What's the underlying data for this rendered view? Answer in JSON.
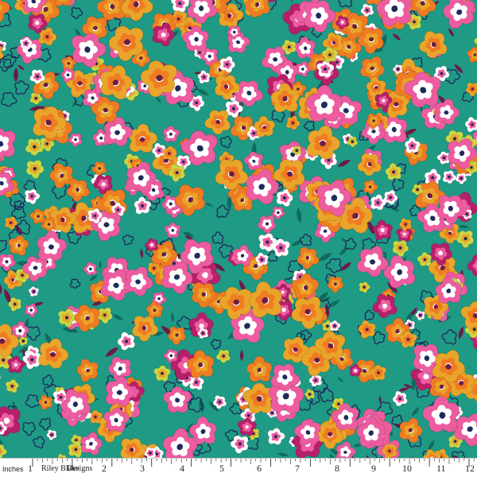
{
  "image": {
    "subject": "Floral cotton quilting fabric swatch",
    "colors": {
      "background": "#1f9a85",
      "pink": "#ec5c9e",
      "magenta": "#b61f6a",
      "orange": "#ef7b22",
      "gold": "#e9a42a",
      "lime": "#c7d847",
      "white": "#ffffff",
      "navy": "#1d2a5a",
      "teal_dark": "#0f6b5d",
      "plum": "#6a1d45"
    }
  },
  "ruler": {
    "unit_label": "Inches",
    "brand": "Riley Blake",
    "brand_suffix": "Designs",
    "numbers": [
      "1",
      "2",
      "3",
      "4",
      "5",
      "6",
      "7",
      "8",
      "9",
      "10",
      "11",
      "12"
    ]
  }
}
